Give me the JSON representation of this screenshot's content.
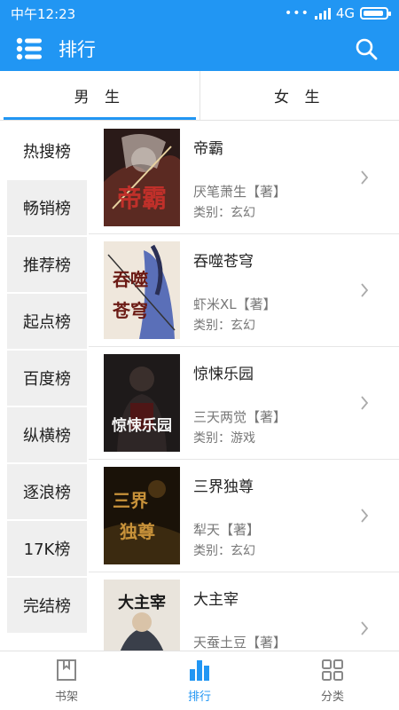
{
  "status_bar": {
    "time": "中午12:23",
    "signal_dots": "•••",
    "network": "4G",
    "battery_level": 0.9
  },
  "app_bar": {
    "title": "排行",
    "menu_icon": "menu-icon",
    "search_icon": "search-icon"
  },
  "tabs": [
    {
      "label": "男 生",
      "active": true
    },
    {
      "label": "女 生",
      "active": false
    }
  ],
  "rank_categories": [
    "热搜榜",
    "畅销榜",
    "推荐榜",
    "起点榜",
    "百度榜",
    "纵横榜",
    "逐浪榜",
    "17K榜",
    "完结榜"
  ],
  "books": [
    {
      "title": "帝霸",
      "author": "厌笔萧生【著】",
      "category": "类别：玄幻",
      "cover_text": "帝霸"
    },
    {
      "title": "吞噬苍穹",
      "author": "虾米XL【著】",
      "category": "类别：玄幻",
      "cover_text": "吞噬苍穹"
    },
    {
      "title": "惊悚乐园",
      "author": "三天两觉【著】",
      "category": "类别：游戏",
      "cover_text": "惊悚乐园"
    },
    {
      "title": "三界独尊",
      "author": "犁天【著】",
      "category": "类别：玄幻",
      "cover_text": "三界独尊"
    },
    {
      "title": "大主宰",
      "author": "天蚕土豆【著】",
      "category": "",
      "cover_text": "大主宰"
    }
  ],
  "bottom_nav": [
    {
      "label": "书架",
      "icon": "bookshelf-icon",
      "active": false
    },
    {
      "label": "排行",
      "icon": "ranking-icon",
      "active": true
    },
    {
      "label": "分类",
      "icon": "category-grid-icon",
      "active": false
    }
  ],
  "colors": {
    "accent": "#2196f3",
    "nav_bg": "#efefef",
    "text": "#222222",
    "muted": "#777777"
  }
}
